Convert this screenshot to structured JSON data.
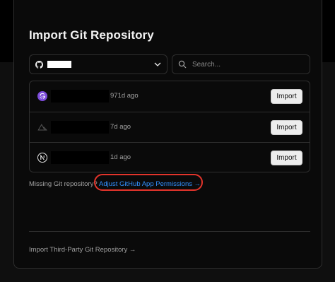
{
  "page": {
    "title": "Import Git Repository"
  },
  "account_select": {
    "provider_icon": "github-icon",
    "chevron_icon": "chevron-down-icon"
  },
  "search": {
    "placeholder": "Search..."
  },
  "repositories": [
    {
      "icon": "gatsby-icon",
      "age": "971d ago",
      "import_label": "Import"
    },
    {
      "icon": "nuxt-icon",
      "age": "7d ago",
      "import_label": "Import"
    },
    {
      "icon": "nextjs-icon",
      "age": "1d ago",
      "import_label": "Import"
    }
  ],
  "footer": {
    "missing_text": "Missing Git repository?",
    "adjust_link": "Adjust GitHub App Permissions →",
    "third_party_link": "Import Third-Party Git Repository →"
  },
  "colors": {
    "background": "#000000",
    "link": "#3291ff",
    "highlight": "#e3342b",
    "button_bg": "#ededed",
    "border": "#2e2e2e"
  }
}
